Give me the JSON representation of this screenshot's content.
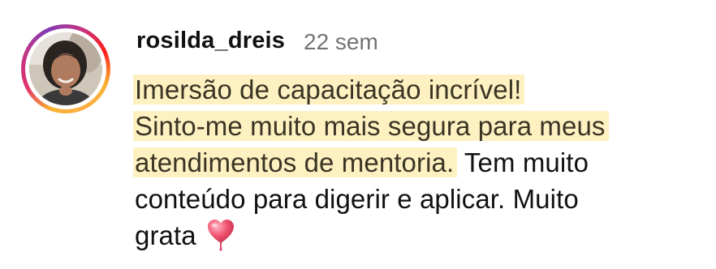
{
  "comment": {
    "username": "rosilda_dreis",
    "timestamp": "22 sem",
    "highlighted_lines": [
      "Imersão de capacitação incrível!",
      "Sinto-me muito mais segura para meus",
      "atendimentos de mentoria."
    ],
    "continuation_inline": "Tem muito",
    "plain_lines": [
      "conteúdo para digerir e aplicar. Muito",
      "grata"
    ],
    "emoji": "heart-icon",
    "colors": {
      "highlight": "#fdf1c2",
      "timestamp": "#737373",
      "heart": "#f0506e"
    }
  }
}
